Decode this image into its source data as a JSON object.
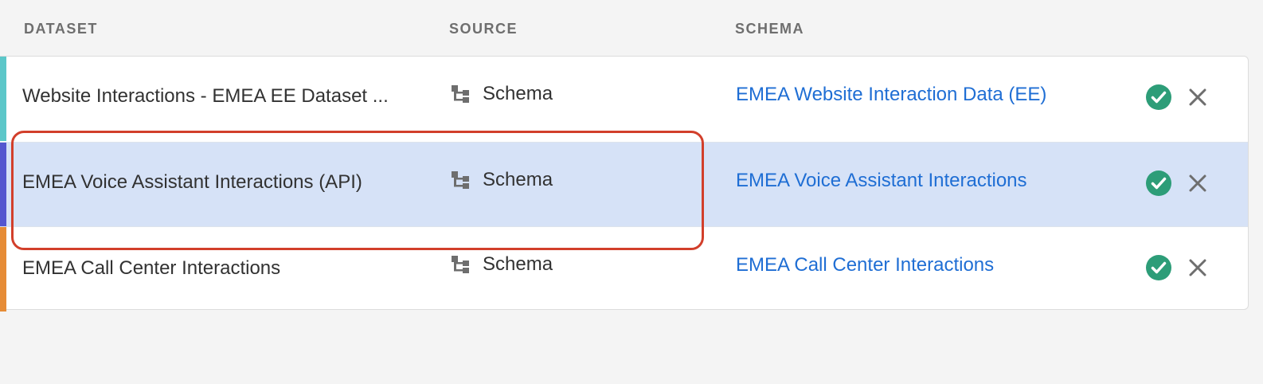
{
  "columns": {
    "dataset": "DATASET",
    "source": "SOURCE",
    "schema": "SCHEMA"
  },
  "rows": [
    {
      "dataset": "Website Interactions - EMEA EE Dataset ...",
      "source": "Schema",
      "source_icon": "schema-tree-icon",
      "schema": "EMEA Website Interaction Data (EE)",
      "stripe_color": "#5cc7c9",
      "status_icon": "check-circle-icon",
      "remove_icon": "close-icon"
    },
    {
      "dataset": "EMEA Voice Assistant Interactions (API)",
      "source": "Schema",
      "source_icon": "schema-tree-icon",
      "schema": "EMEA Voice Assistant Interactions",
      "stripe_color": "#5456cf",
      "selected": true,
      "status_icon": "check-circle-icon",
      "remove_icon": "close-icon"
    },
    {
      "dataset": "EMEA Call Center Interactions",
      "source": "Schema",
      "source_icon": "schema-tree-icon",
      "schema": "EMEA Call Center Interactions",
      "stripe_color": "#e68c36",
      "status_icon": "check-circle-icon",
      "remove_icon": "close-icon"
    }
  ],
  "colors": {
    "link": "#1f6ed4",
    "selected_row": "#d6e2f7",
    "check": "#2d9d78",
    "highlight_outline": "#d23f2b"
  }
}
